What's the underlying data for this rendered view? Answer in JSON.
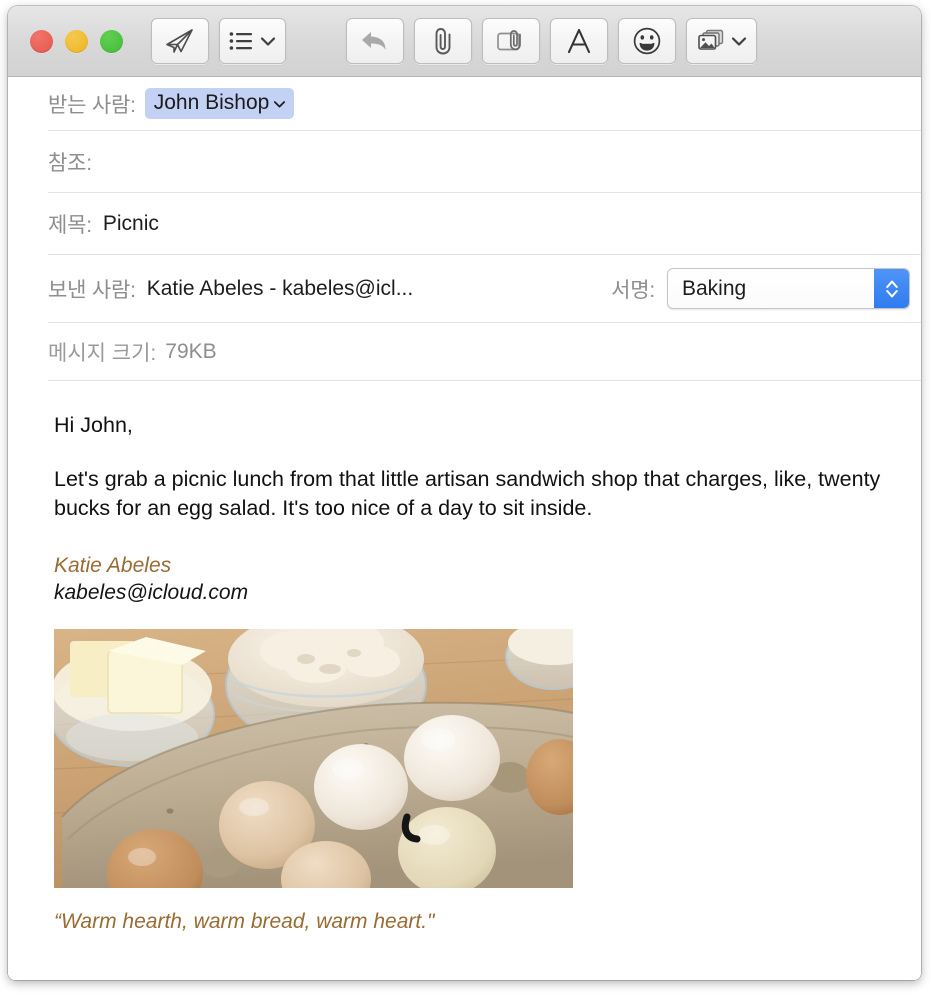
{
  "window": {
    "traffic_lights": [
      {
        "name": "close",
        "color": "#e4564c"
      },
      {
        "name": "minimize",
        "color": "#ecb427"
      },
      {
        "name": "maximize",
        "color": "#3fbd37"
      }
    ]
  },
  "toolbar": {
    "buttons": [
      {
        "name": "send-button",
        "icon": "paper-plane-icon",
        "label": "",
        "has_chevron": false
      },
      {
        "name": "header-fields-button",
        "icon": "list-icon",
        "label": "",
        "has_chevron": true
      },
      {
        "name": "reply-button",
        "icon": "reply-arrow-icon",
        "label": "",
        "has_chevron": false,
        "disabled": true
      },
      {
        "name": "attach-button",
        "icon": "paperclip-icon",
        "label": "",
        "has_chevron": false
      },
      {
        "name": "markup-attachment-button",
        "icon": "card-paperclip-icon",
        "label": "",
        "has_chevron": false
      },
      {
        "name": "format-button",
        "icon": "letter-a-icon",
        "label": "A",
        "has_chevron": false
      },
      {
        "name": "emoji-button",
        "icon": "smiley-icon",
        "label": "",
        "has_chevron": false
      },
      {
        "name": "photo-browser-button",
        "icon": "photos-icon",
        "label": "",
        "has_chevron": true
      }
    ]
  },
  "compose": {
    "to": {
      "label": "받는 사람:",
      "recipient": "John Bishop",
      "token_color": "#c3d1f5"
    },
    "cc": {
      "label": "참조:",
      "value": ""
    },
    "subject": {
      "label": "제목:",
      "value": "Picnic"
    },
    "from": {
      "label": "보낸 사람:",
      "value": "Katie Abeles - kabeles@icl..."
    },
    "signature": {
      "label": "서명:",
      "selected": "Baking",
      "accent_color": "#3f86f5"
    },
    "message_size": {
      "label": "메시지 크기:",
      "value": "79KB"
    }
  },
  "message": {
    "greeting": "Hi John,",
    "paragraph": "Let's grab a picnic lunch from that little artisan sandwich shop that charges, like, twenty bucks for an egg salad. It's too nice of a day to sit inside.",
    "signature_name": "Katie Abeles",
    "signature_email": "kabeles@icloud.com",
    "signature_name_color": "#9a6b33",
    "image_alt": "eggs-in-carton-with-butter-and-flour-photo",
    "quote": "“Warm hearth, warm bread, warm heart.\""
  }
}
